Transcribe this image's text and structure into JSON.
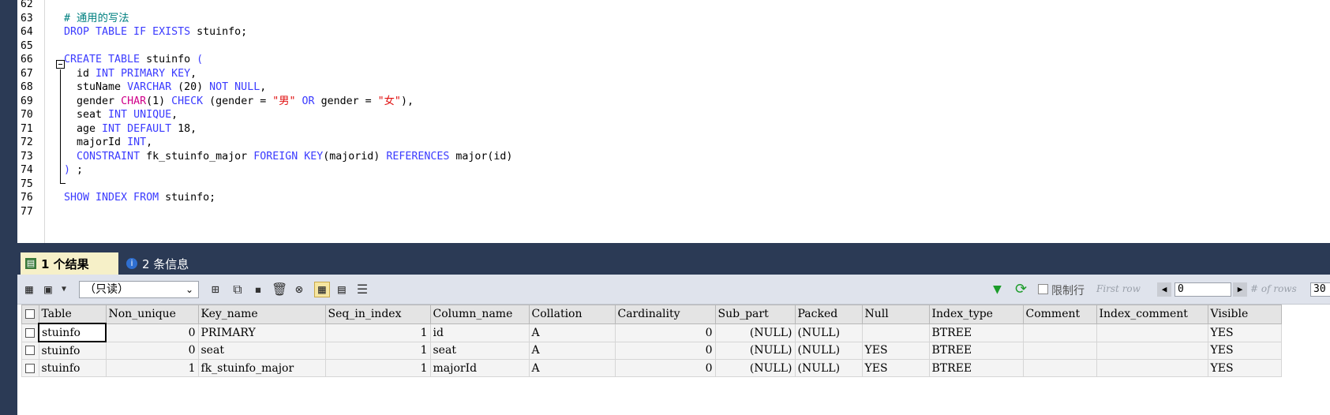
{
  "editor": {
    "lines": [
      {
        "n": "62",
        "html": ""
      },
      {
        "n": "63",
        "html": "<span class='cm'># 通用的写法</span>"
      },
      {
        "n": "64",
        "html": "<span class='kw'>DROP TABLE IF EXISTS</span> stuinfo;"
      },
      {
        "n": "65",
        "html": ""
      },
      {
        "n": "66",
        "html": "<span class='kw'>CREATE TABLE</span> stuinfo <span class='kw'>(</span>"
      },
      {
        "n": "67",
        "html": "  id <span class='kw'>INT PRIMARY KEY</span>,"
      },
      {
        "n": "68",
        "html": "  stuName <span class='kw'>VARCHAR</span> (20) <span class='kw'>NOT NULL</span>,"
      },
      {
        "n": "69",
        "html": "  gender <span class='ty'>CHAR</span>(1) <span class='kw'>CHECK</span> (gender = <span class='str'>\"男\"</span> <span class='kw'>OR</span> gender = <span class='str'>\"女\"</span>),"
      },
      {
        "n": "70",
        "html": "  seat <span class='kw'>INT UNIQUE</span>,"
      },
      {
        "n": "71",
        "html": "  age <span class='kw'>INT DEFAULT</span> 18,"
      },
      {
        "n": "72",
        "html": "  majorId <span class='kw'>INT</span>,"
      },
      {
        "n": "73",
        "html": "  <span class='kw'>CONSTRAINT</span> fk_stuinfo_major <span class='kw'>FOREIGN KEY</span>(majorid) <span class='kw'>REFERENCES</span> major(id)"
      },
      {
        "n": "74",
        "html": "<span class='kw'>)</span> ;"
      },
      {
        "n": "75",
        "html": ""
      },
      {
        "n": "76",
        "html": "<span class='kw'>SHOW INDEX FROM</span> stuinfo;"
      },
      {
        "n": "77",
        "html": ""
      }
    ]
  },
  "tabs": {
    "result_label": "1 个结果",
    "info_label": "2 条信息"
  },
  "toolbar": {
    "mode_value": "（只读）",
    "limit_label": "限制行",
    "first_row_label": "First row",
    "first_row_value": "0",
    "rows_label": "# of rows",
    "rows_value": "30"
  },
  "results": {
    "columns": [
      "Table",
      "Non_unique",
      "Key_name",
      "Seq_in_index",
      "Column_name",
      "Collation",
      "Cardinality",
      "Sub_part",
      "Packed",
      "Null",
      "Index_type",
      "Comment",
      "Index_comment",
      "Visible"
    ],
    "rows": [
      [
        "stuinfo",
        "0",
        "PRIMARY",
        "1",
        "id",
        "A",
        "0",
        "(NULL)",
        "(NULL)",
        "",
        "BTREE",
        "",
        "",
        "YES"
      ],
      [
        "stuinfo",
        "0",
        "seat",
        "1",
        "seat",
        "A",
        "0",
        "(NULL)",
        "(NULL)",
        "YES",
        "BTREE",
        "",
        "",
        "YES"
      ],
      [
        "stuinfo",
        "1",
        "fk_stuinfo_major",
        "1",
        "majorId",
        "A",
        "0",
        "(NULL)",
        "(NULL)",
        "YES",
        "BTREE",
        "",
        "",
        "YES"
      ]
    ]
  },
  "colors": {
    "keyword": "#3b3bff",
    "comment": "#008080",
    "string": "#e01010",
    "type": "#d0008a",
    "panel_dark": "#2b3a55"
  }
}
